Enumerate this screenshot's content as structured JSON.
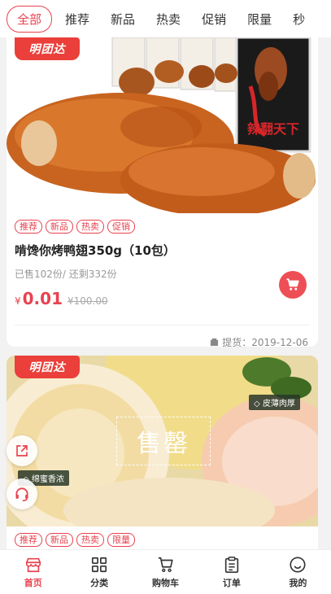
{
  "tabs": [
    "全部",
    "推荐",
    "新品",
    "热卖",
    "促销",
    "限量",
    "秒"
  ],
  "products": [
    {
      "brand": "明团达",
      "tags": [
        "推荐",
        "新品",
        "热卖",
        "促销"
      ],
      "title": "啃馋你烤鸭翅350g（10包）",
      "sold": "已售102份/ 还剩332份",
      "currency": "¥",
      "price": "0.01",
      "orig_price": "¥100.00",
      "pickup": "提货：2019-12-06",
      "package_text": "辣翻天下"
    },
    {
      "brand": "明团达",
      "tags": [
        "推荐",
        "新品",
        "热卖",
        "限量"
      ],
      "soldout": "售罄",
      "chip_left": "◇ 绵蜜香浓",
      "chip_right": "◇ 皮薄肉厚"
    }
  ],
  "nav": [
    {
      "label": "首页",
      "icon": "store-icon"
    },
    {
      "label": "分类",
      "icon": "grid-icon"
    },
    {
      "label": "购物车",
      "icon": "cart-icon"
    },
    {
      "label": "订单",
      "icon": "clipboard-icon"
    },
    {
      "label": "我的",
      "icon": "smile-icon"
    }
  ],
  "colors": {
    "accent": "#e8424f"
  }
}
